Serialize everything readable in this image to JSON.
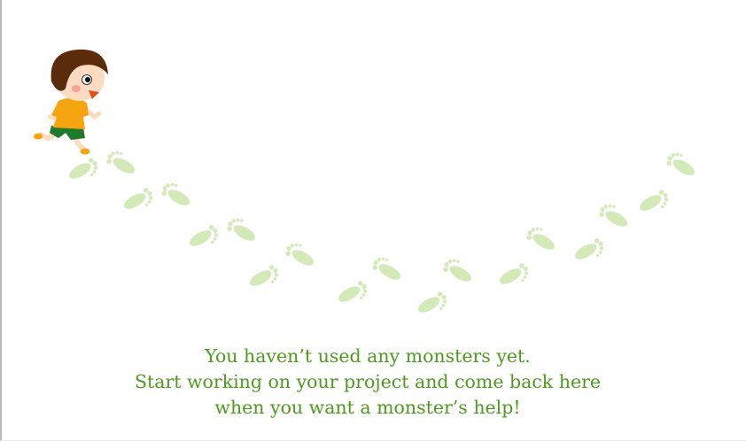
{
  "empty_state": {
    "line1": "You haven’t used any monsters yet.",
    "line2": "Start working on your project and come back here",
    "line3": "when you want a monster’s help!"
  },
  "colors": {
    "message_text": "#4e9a1e",
    "footprints": "#d4e9b8",
    "hair": "#5b2c0b",
    "shirt": "#f6a511",
    "shorts": "#1f7a2c",
    "skin": "#fcdcc0"
  },
  "icons": {
    "character": "running-child-icon",
    "footprint": "footprint-icon"
  }
}
